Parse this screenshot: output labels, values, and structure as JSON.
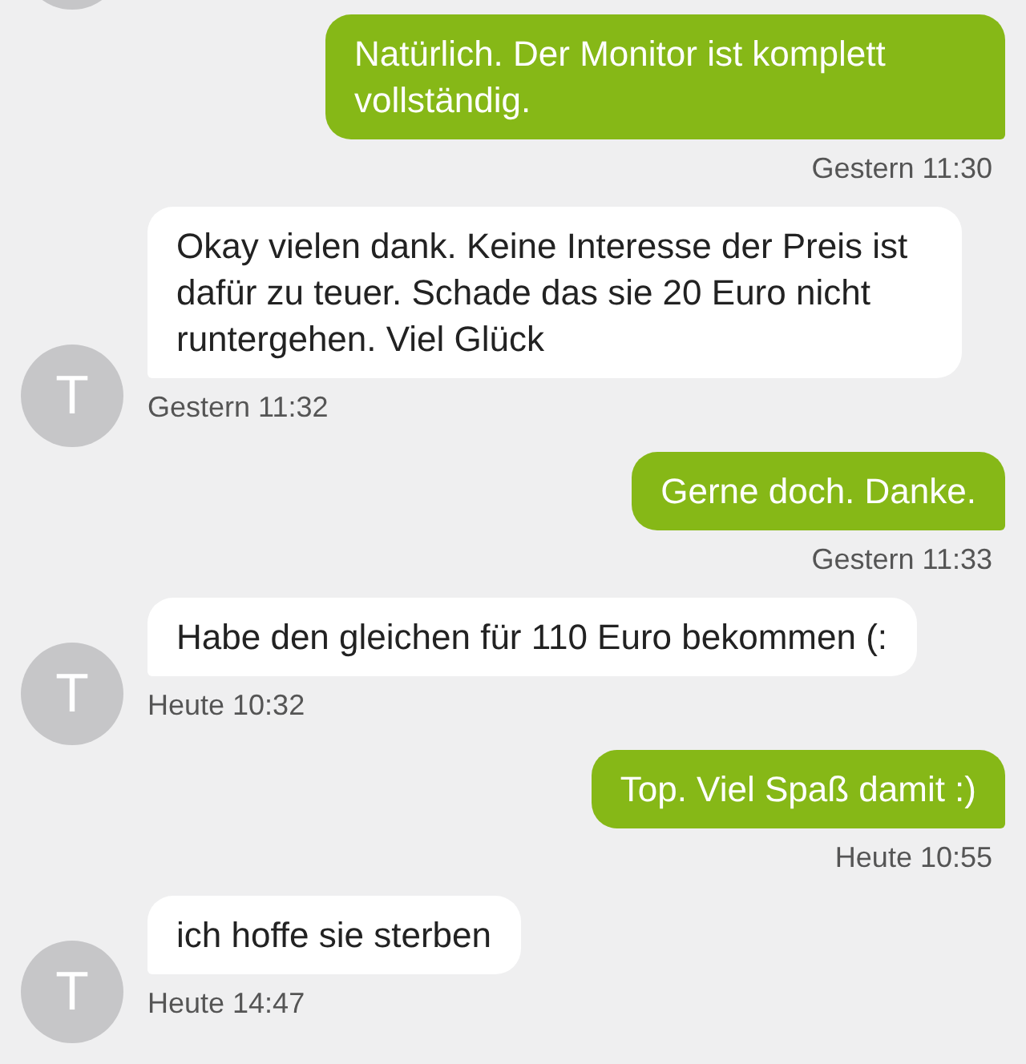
{
  "avatar_above": true,
  "messages": [
    {
      "kind": "outgoing",
      "text": "Natürlich. Der Monitor ist komplett vollständig.",
      "time": "Gestern 11:30"
    },
    {
      "kind": "incoming",
      "initial": "T",
      "text": "Okay vielen dank. Keine Interesse der Preis ist dafür zu teuer. Schade das sie 20 Euro nicht runtergehen. Viel Glück",
      "time": "Gestern 11:32"
    },
    {
      "kind": "outgoing",
      "text": "Gerne doch. Danke.",
      "time": "Gestern 11:33"
    },
    {
      "kind": "incoming",
      "initial": "T",
      "text": "Habe den gleichen für 110 Euro bekommen (:",
      "time": "Heute 10:32"
    },
    {
      "kind": "outgoing",
      "text": "Top. Viel Spaß damit :)",
      "time": "Heute 10:55"
    },
    {
      "kind": "incoming",
      "initial": "T",
      "text": "ich hoffe sie sterben",
      "time": "Heute 14:47"
    }
  ]
}
